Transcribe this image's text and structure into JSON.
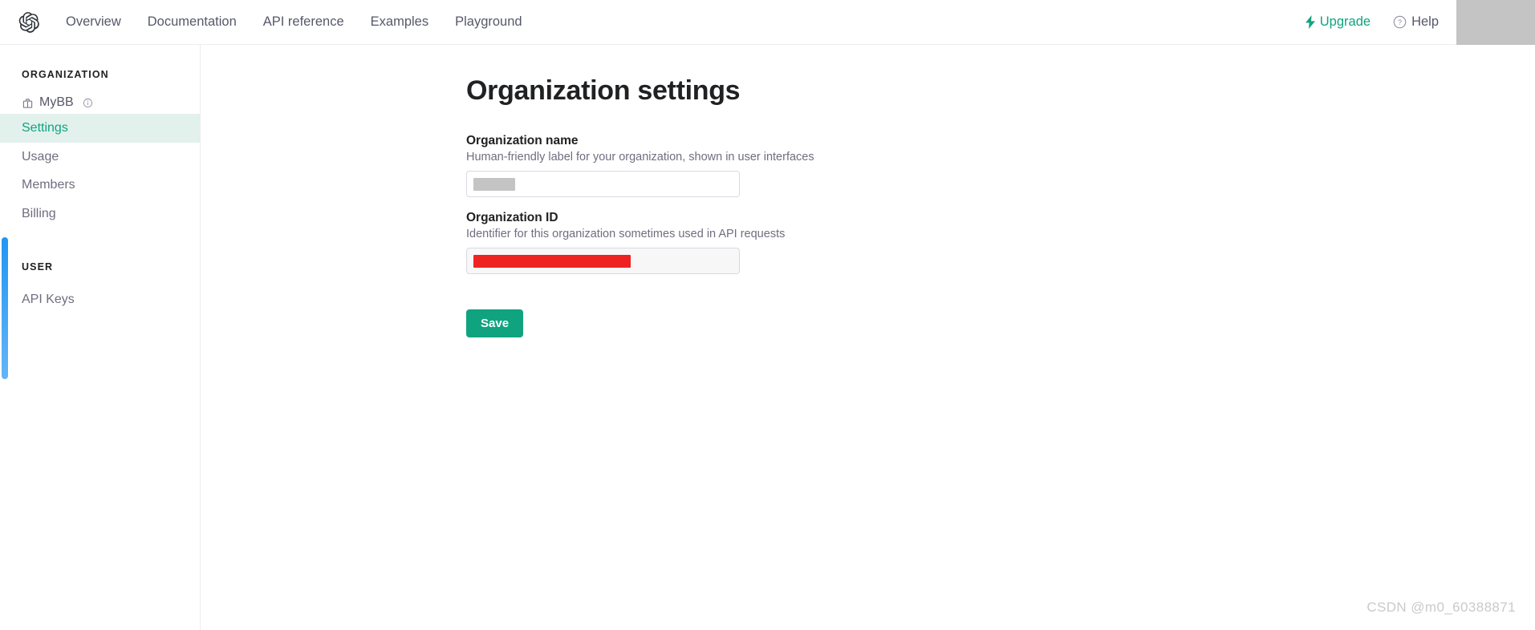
{
  "header": {
    "logo_name": "openai-logo",
    "nav_links": [
      {
        "label": "Overview"
      },
      {
        "label": "Documentation"
      },
      {
        "label": "API reference"
      },
      {
        "label": "Examples"
      },
      {
        "label": "Playground"
      }
    ],
    "upgrade_label": "Upgrade",
    "upgrade_color": "#10a37f",
    "help_label": "Help",
    "avatar_redacted": true
  },
  "sidebar": {
    "org_heading": "ORGANIZATION",
    "org_name": "MyBB",
    "items": [
      {
        "label": "Settings",
        "active": true
      },
      {
        "label": "Usage",
        "active": false
      },
      {
        "label": "Members",
        "active": false
      },
      {
        "label": "Billing",
        "active": false
      }
    ],
    "user_heading": "USER",
    "user_items": [
      {
        "label": "API Keys",
        "active": false
      }
    ],
    "active_color": "#10a37f",
    "active_bg": "#e3f1ed",
    "scrollbar_color": "#2196f3"
  },
  "main": {
    "title": "Organization settings",
    "fields": [
      {
        "label": "Organization name",
        "help": "Human-friendly label for your organization, shown in user interfaces",
        "value": "",
        "redacted": true,
        "redaction_color": "#c4c4c4",
        "disabled": false
      },
      {
        "label": "Organization ID",
        "help": "Identifier for this organization sometimes used in API requests",
        "value": "",
        "redacted": true,
        "redaction_color": "#ef2222",
        "disabled": true
      }
    ],
    "save_label": "Save",
    "save_color": "#10a37f"
  },
  "watermark": {
    "text": "CSDN @m0_60388871"
  }
}
